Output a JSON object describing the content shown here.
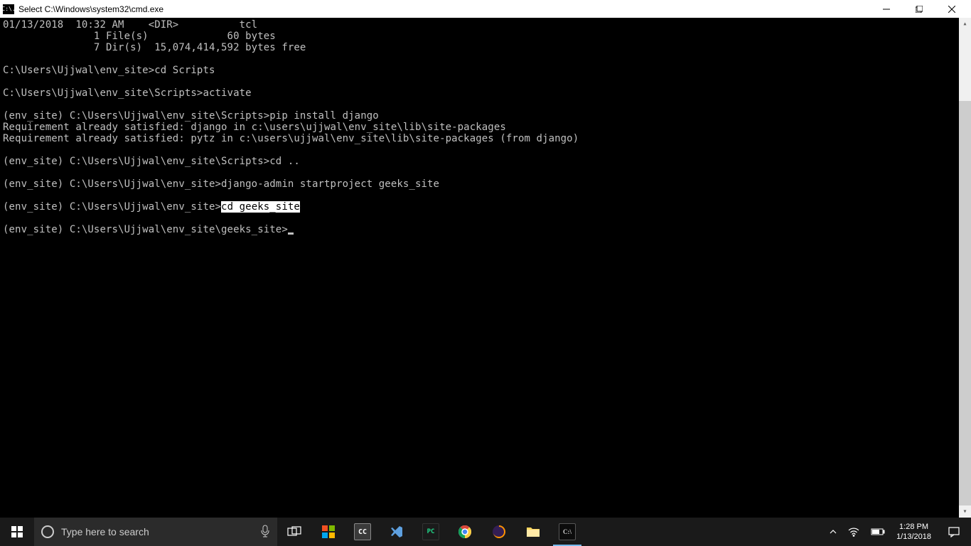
{
  "window": {
    "icon_label": "C:\\.",
    "title": "Select C:\\Windows\\system32\\cmd.exe"
  },
  "terminal": {
    "lines": [
      "01/13/2018  10:32 AM    <DIR>          tcl",
      "               1 File(s)             60 bytes",
      "               7 Dir(s)  15,074,414,592 bytes free",
      "",
      "C:\\Users\\Ujjwal\\env_site>cd Scripts",
      "",
      "C:\\Users\\Ujjwal\\env_site\\Scripts>activate",
      "",
      "(env_site) C:\\Users\\Ujjwal\\env_site\\Scripts>pip install django",
      "Requirement already satisfied: django in c:\\users\\ujjwal\\env_site\\lib\\site-packages",
      "Requirement already satisfied: pytz in c:\\users\\ujjwal\\env_site\\lib\\site-packages (from django)",
      "",
      "(env_site) C:\\Users\\Ujjwal\\env_site\\Scripts>cd ..",
      "",
      "(env_site) C:\\Users\\Ujjwal\\env_site>django-admin startproject geeks_site",
      ""
    ],
    "highlighted_line": {
      "prefix": "(env_site) C:\\Users\\Ujjwal\\env_site>",
      "highlighted": "cd geeks_site"
    },
    "final_prompt": "(env_site) C:\\Users\\Ujjwal\\env_site\\geeks_site>"
  },
  "taskbar": {
    "search_placeholder": "Type here to search"
  },
  "tray": {
    "time": "1:28 PM",
    "date": "1/13/2018"
  }
}
